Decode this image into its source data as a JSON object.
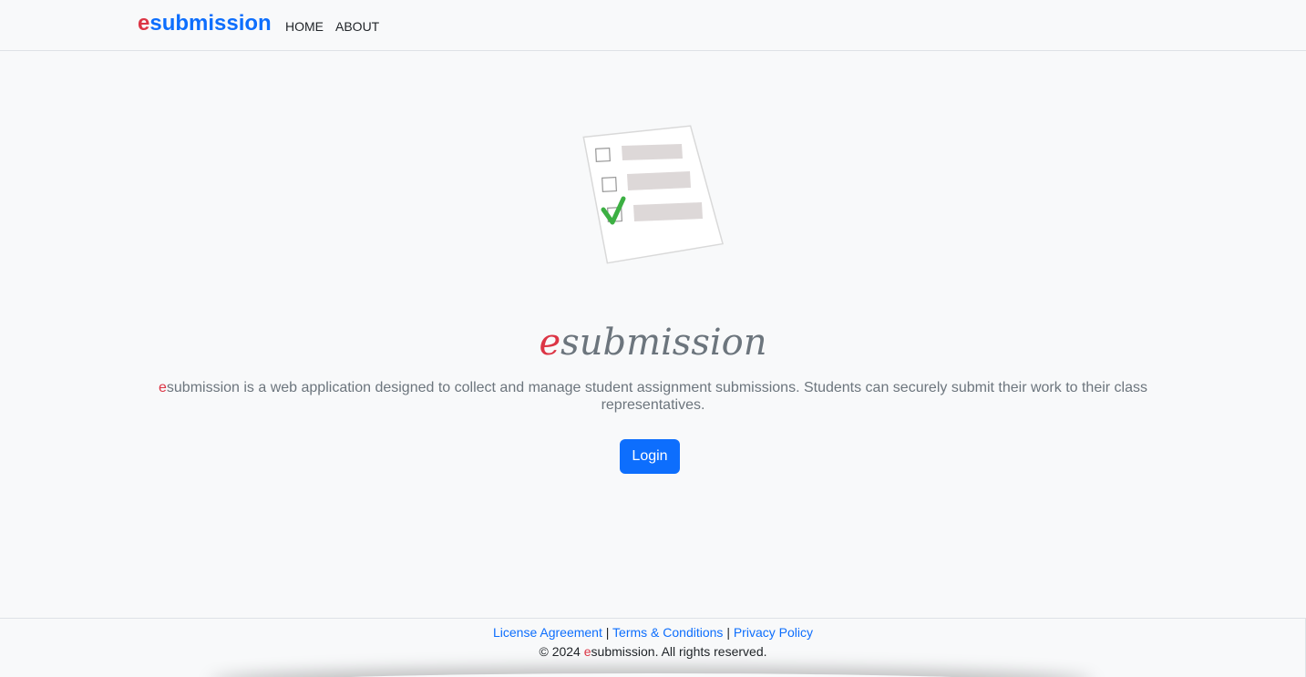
{
  "nav": {
    "brand_first": "e",
    "brand_rest": "submission",
    "home_label": "HOME",
    "about_label": "ABOUT"
  },
  "hero": {
    "illustration_icon": "checklist-document-icon",
    "title_first": "e",
    "title_rest": "submission",
    "description_first": "e",
    "description_rest": "submission is a web application designed to collect and manage student assignment submissions. Students can securely submit their work to their class representatives.",
    "login_label": "Login"
  },
  "footer": {
    "license_label": "License Agreement",
    "terms_label": "Terms & Conditions",
    "privacy_label": "Privacy Policy",
    "separator": "|",
    "copyright_prefix": "© 2024 ",
    "copyright_brand_first": "e",
    "copyright_brand_rest": "submission",
    "copyright_suffix": ". All rights reserved."
  },
  "colors": {
    "primary": "#0d6efd",
    "accent_red": "#dc3545",
    "muted_text": "#6c757d",
    "background": "#f8f9fa",
    "check_green": "#3cb043"
  }
}
